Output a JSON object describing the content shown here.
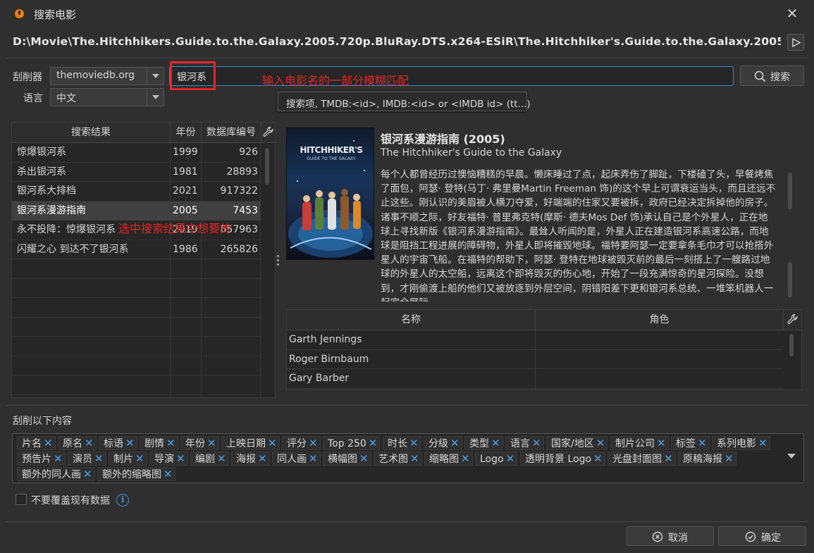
{
  "window": {
    "title": "搜索电影",
    "path": "D:\\Movie\\The.Hitchhikers.Guide.to.the.Galaxy.2005.720p.BluRay.DTS.x264-ESiR\\The.Hitchhiker's.Guide.to.the.Galaxy.2005...."
  },
  "form": {
    "scraper_label": "刮削器",
    "scraper_value": "themoviedb.org",
    "language_label": "语言",
    "language_value": "中文",
    "search_value": "银河系",
    "search_button": "搜索",
    "tooltip": "搜索项, TMDB:<id>, IMDB:<id> or <IMDB id> (tt...)"
  },
  "annotations": {
    "input_hint": "输入电影名的一部分模糊匹配",
    "select_hint": "选中搜索结果中想要的"
  },
  "results": {
    "headers": [
      "搜索结果",
      "年份",
      "数据库编号"
    ],
    "rows": [
      {
        "title": "惊爆银河系",
        "year": "1999",
        "id": "926"
      },
      {
        "title": "杀出银河系",
        "year": "1981",
        "id": "28893"
      },
      {
        "title": "银河系大排档",
        "year": "2021",
        "id": "917322"
      },
      {
        "title": "银河系漫游指南",
        "year": "2005",
        "id": "7453"
      },
      {
        "title": "永不投降：惊爆银河系",
        "year": "2019",
        "id": "657963"
      },
      {
        "title": "闪耀之心 到达不了银河系",
        "year": "1986",
        "id": "265826"
      }
    ],
    "selected_index": 3
  },
  "detail": {
    "title": "银河系漫游指南 (2005)",
    "original_title": "The Hitchhiker's Guide to the Galaxy",
    "plot": "每个人都曾经历过懊恼糟糕的早晨。懒床睡过了点，起床弄伤了脚趾，下楼磕了头，早餐烤焦了面包，阿瑟· 登特(马丁· 弗里曼Martin Freeman 饰)的这个早上可谓衰运当头，而且还远不止这些。刚认识的美眉被人横刀夺爱，好端端的住家又要被拆，政府已经决定拆掉他的房子。诸事不顺之际，好友福特· 普里弗克特(摩斯· 德夫Mos Def 饰)承认自己是个外星人，正在地球上寻找新版《银河系漫游指南》。最耸人听闻的是，外星人正在建造银河系高速公路，而地球是阻挡工程进展的障碍物，外星人即将摧毁地球。福特要阿瑟一定要拿条毛巾才可以抢搭外星人的宇宙飞船。在福特的帮助下，阿瑟· 登特在地球被毁灭前的最后一刻搭上了一艘路过地球的外星人的太空船，远离这个即将毁灭的伤心地，开始了一段充满惊奇的星河探险。没想到，才刚偷渡上船的他们又被放逐到外层空间，阴错阳差下更和银河系总统、一堆笨机器人一起完全展际",
    "poster_text": [
      "HITCHHIKER'S",
      "GUIDE TO THE GALAXY"
    ],
    "cast_headers": [
      "名称",
      "角色"
    ],
    "cast": [
      {
        "name": "Garth Jennings",
        "role": ""
      },
      {
        "name": "Roger Birnbaum",
        "role": ""
      },
      {
        "name": "Gary Barber",
        "role": ""
      }
    ]
  },
  "scrape": {
    "label": "刮削以下内容",
    "tags": [
      "片名",
      "原名",
      "标语",
      "剧情",
      "年份",
      "上映日期",
      "评分",
      "Top 250",
      "时长",
      "分级",
      "类型",
      "语言",
      "国家/地区",
      "制片公司",
      "标签",
      "系列电影",
      "预告片",
      "演员",
      "制片",
      "导演",
      "编剧",
      "海报",
      "同人画",
      "横幅图",
      "艺术图",
      "缩略图",
      "Logo",
      "透明背景 Logo",
      "光盘封面图",
      "原稿海报",
      "额外的同人画",
      "额外的缩略图"
    ],
    "no_overwrite": "不要覆盖现有数据"
  },
  "footer": {
    "cancel": "取消",
    "ok": "确定"
  },
  "colors": {
    "accent": "#3e8ac9",
    "annotation": "#e32626",
    "tag_remove": "#4aa0e6"
  }
}
